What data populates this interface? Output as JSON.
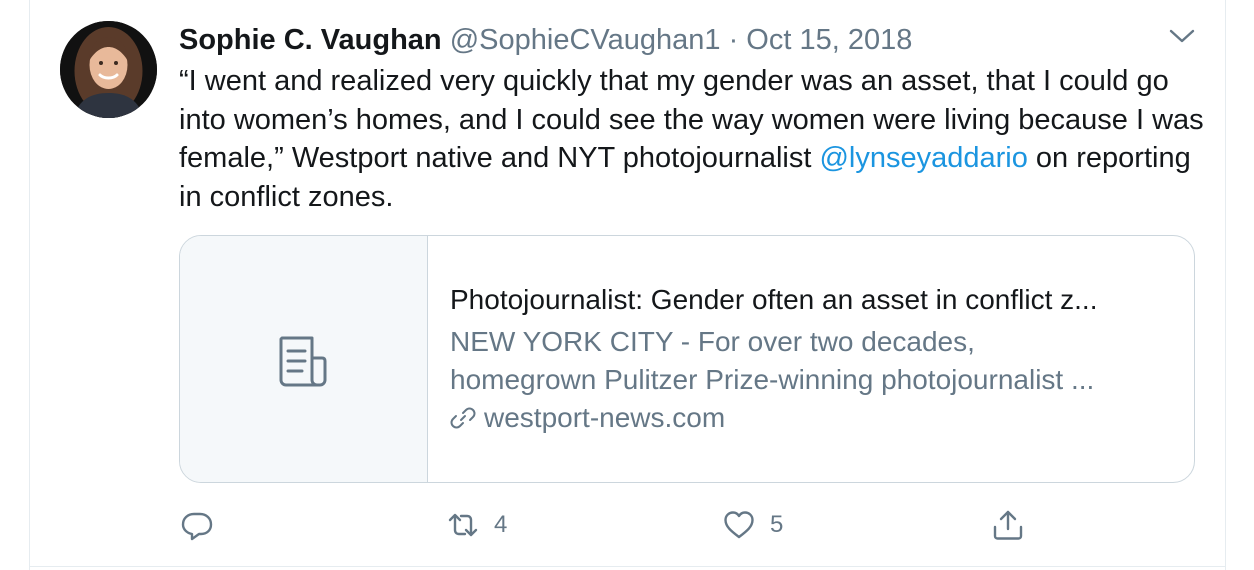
{
  "tweet": {
    "display_name": "Sophie C. Vaughan",
    "handle": "@SophieCVaughan1",
    "separator": "·",
    "date": "Oct 15, 2018",
    "text_before_mention": "“I went and realized very quickly that my gender was an asset, that I could go into women’s homes, and I could see the way women were living because I was female,” Westport native and NYT photojournalist ",
    "mention": "@lynseyaddario",
    "text_after_mention": " on reporting in conflict zones."
  },
  "card": {
    "title": "Photojournalist: Gender often an asset in conflict z...",
    "description_line1": "NEW YORK CITY - For over two decades,",
    "description_line2": "homegrown Pulitzer Prize-winning photojournalist ...",
    "domain": "westport-news.com",
    "media_icon": "document-icon",
    "link_icon": "link-icon"
  },
  "actions": {
    "reply_icon": "reply-icon",
    "retweet_icon": "retweet-icon",
    "retweet_count": "4",
    "like_icon": "heart-icon",
    "like_count": "5",
    "share_icon": "share-icon"
  },
  "colors": {
    "text": "#14171a",
    "secondary": "#657786",
    "link": "#1b95e0",
    "border": "#ccd6dd",
    "media_bg": "#f5f8fa"
  }
}
